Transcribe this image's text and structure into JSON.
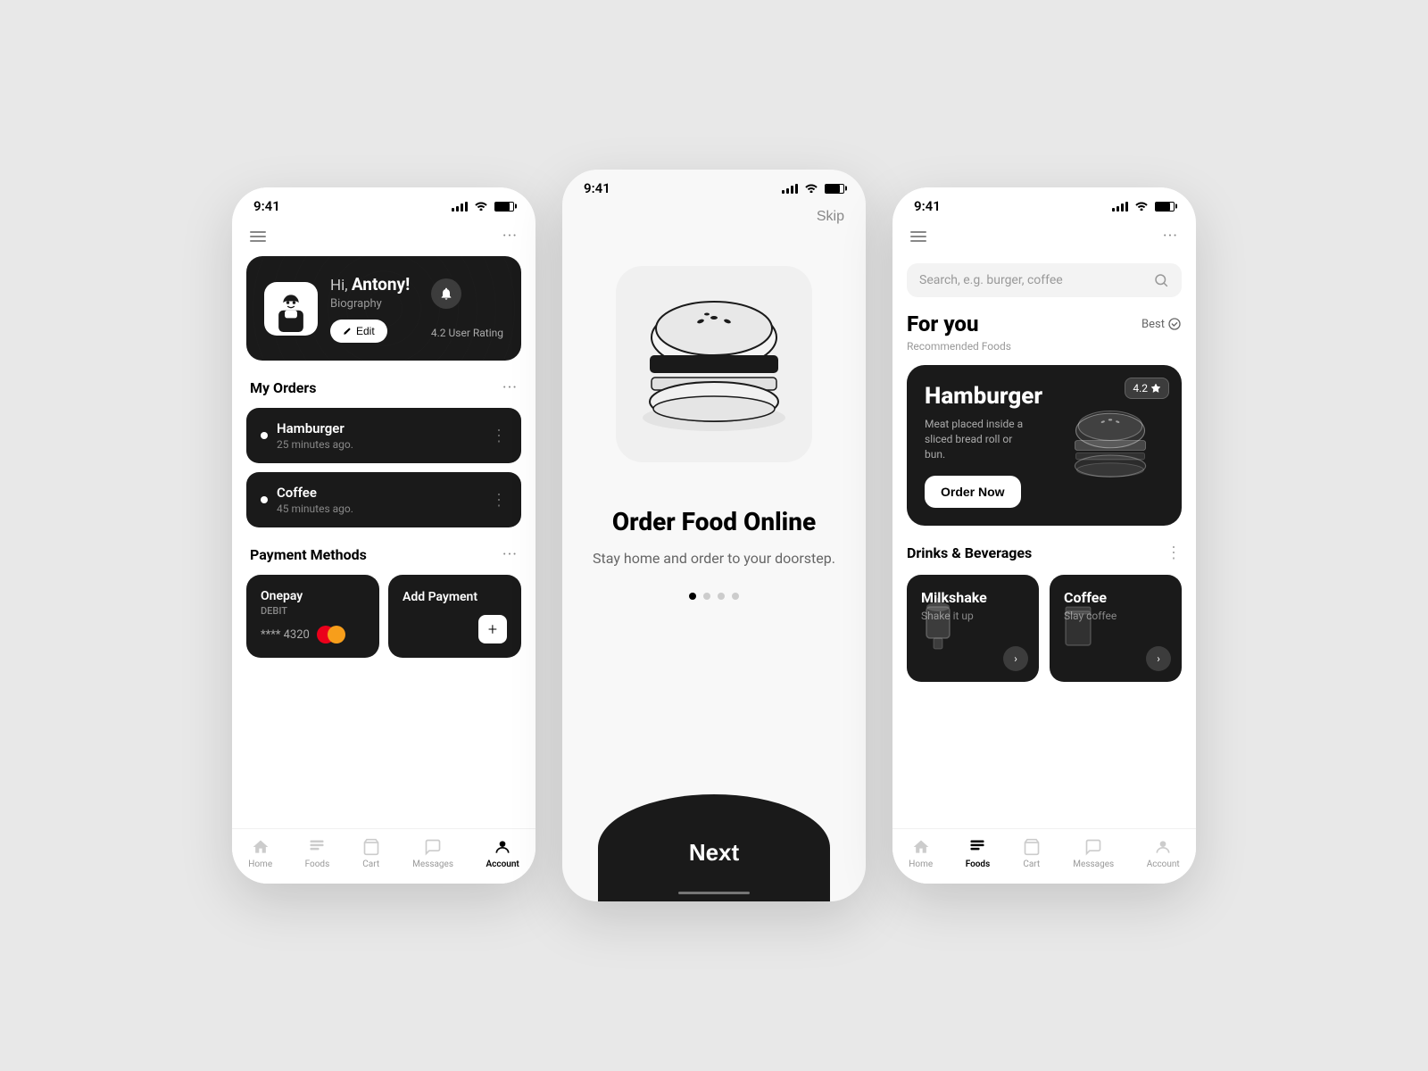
{
  "screen1": {
    "status_time": "9:41",
    "top_dots": "···",
    "profile": {
      "greeting": "Hi, ",
      "name": "Antony!",
      "bio": "Biography",
      "edit_label": "Edit",
      "rating": "4.2 User Rating",
      "notification_icon": "bell"
    },
    "orders": {
      "section_title": "My Orders",
      "items": [
        {
          "name": "Hamburger",
          "time": "25 minutes ago."
        },
        {
          "name": "Coffee",
          "time": "45 minutes ago."
        }
      ]
    },
    "payment": {
      "section_title": "Payment Methods",
      "card_name": "Onepay",
      "card_type": "DEBIT",
      "card_number": "**** 4320",
      "add_title": "Add Payment"
    },
    "nav": {
      "items": [
        "Home",
        "Foods",
        "Cart",
        "Messages",
        "Account"
      ],
      "active": "Account"
    }
  },
  "screen2": {
    "status_time": "9:41",
    "skip_label": "Skip",
    "title": "Order Food Online",
    "subtitle": "Stay home and order to your doorstep.",
    "next_label": "Next",
    "dots": [
      true,
      false,
      false,
      false
    ]
  },
  "screen3": {
    "status_time": "9:41",
    "search_placeholder": "Search, e.g. burger, coffee",
    "for_you": {
      "title": "For you",
      "best_label": "Best",
      "recommended_label": "Recommended Foods"
    },
    "featured": {
      "title": "Hamburger",
      "description": "Meat placed inside a sliced bread roll or bun.",
      "rating": "4.2",
      "order_button": "Order Now"
    },
    "drinks_section": {
      "title": "Drinks & Beverages",
      "items": [
        {
          "name": "Milkshake",
          "desc": "Shake it up"
        },
        {
          "name": "Coffee",
          "desc": "Slay coffee"
        }
      ]
    },
    "nav": {
      "items": [
        "Home",
        "Foods",
        "Cart",
        "Messages",
        "Account"
      ],
      "active": "Foods"
    }
  }
}
